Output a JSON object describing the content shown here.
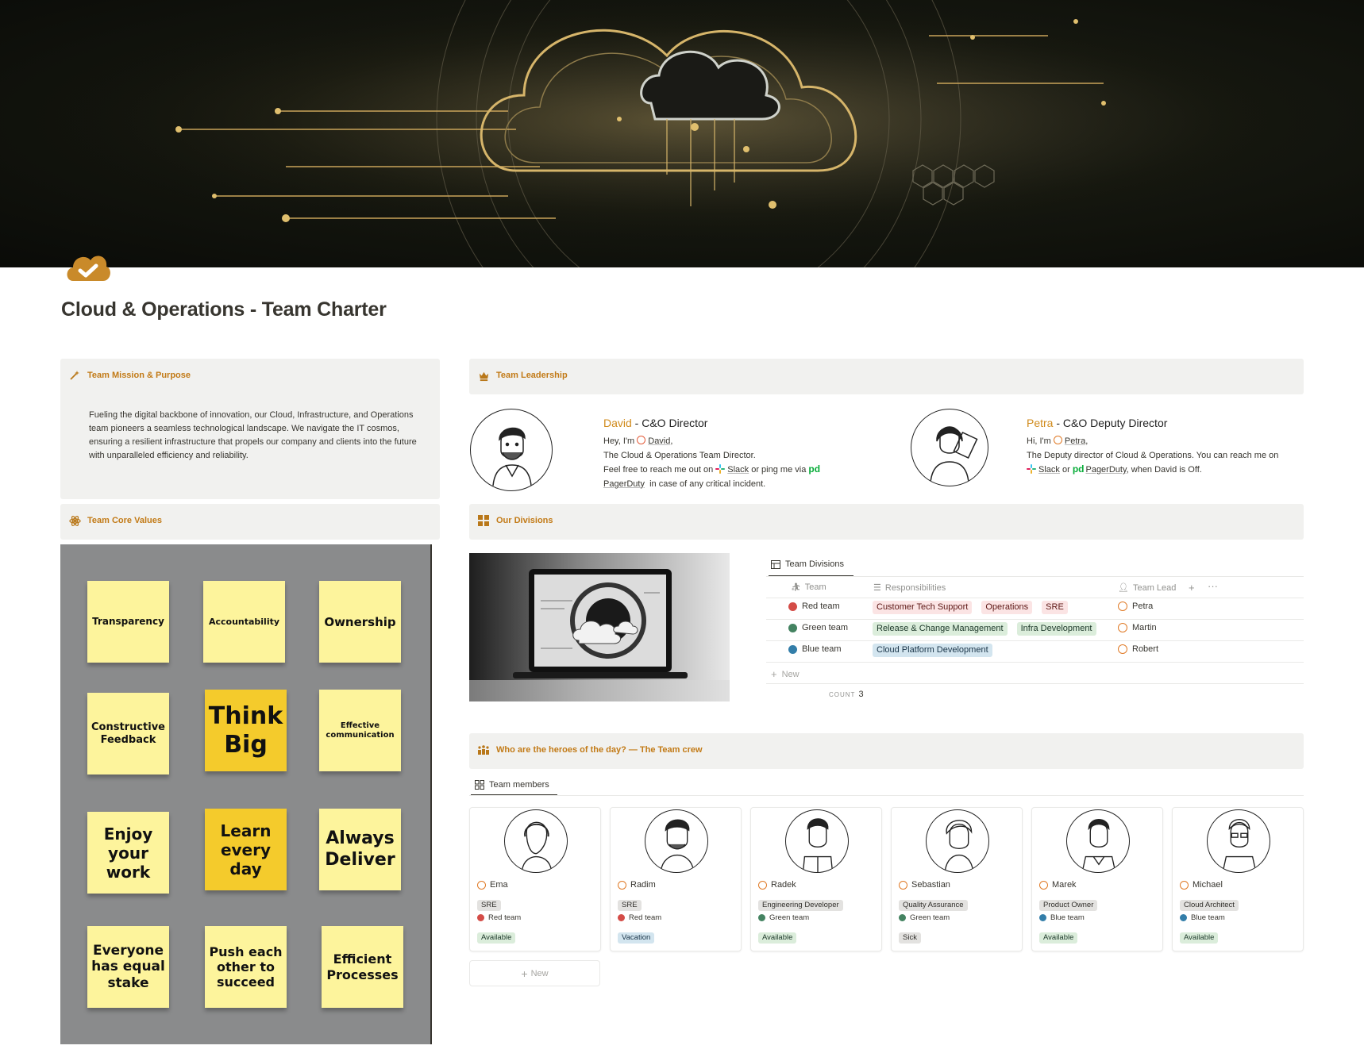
{
  "page": {
    "title": "Cloud & Operations - Team Charter",
    "icon": "cloud-check-icon"
  },
  "mission": {
    "heading": "Team Mission & Purpose",
    "icon": "magic-wand-icon",
    "text": "Fueling the digital backbone of innovation, our Cloud, Infrastructure, and Operations team pioneers a seamless technological landscape. We navigate the IT cosmos, ensuring a resilient infrastructure that propels our company and clients into the future with unparalleled efficiency and reliability."
  },
  "values": {
    "heading": "Team Core Values",
    "icon": "atom-icon",
    "notes": [
      "Transparency",
      "Accountability",
      "Ownership",
      "Constructive Feedback",
      "Think Big",
      "Effective communication",
      "Enjoy your work",
      "Learn every day",
      "Always Deliver",
      "Everyone has equal stake",
      "Push each other to succeed",
      "Efficient Processes"
    ]
  },
  "leadership": {
    "heading": "Team Leadership",
    "icon": "crown-icon",
    "david": {
      "name": "David",
      "title": " - C&O Director",
      "hey": "Hey, I'm",
      "mention": "David",
      "line2": "The Cloud & Operations Team Director.",
      "line3a": "Feel free to reach me out on",
      "slack": "Slack",
      "line3b": "or ping me via",
      "pagerduty": "PagerDuty",
      "line4": "in case of any critical incident."
    },
    "petra": {
      "name": "Petra",
      "title": " - C&O Deputy Director",
      "hi": "Hi, I'm",
      "mention": "Petra",
      "line2": "The Deputy director of Cloud & Operations. You can reach me on",
      "slack": "Slack",
      "or": "or",
      "pagerduty": "PagerDuty",
      "tail": ", when David is Off."
    }
  },
  "divisions": {
    "heading": "Our Divisions",
    "icon": "grid-icon",
    "view_label": "Team Divisions",
    "columns": {
      "team": "Team",
      "responsibilities": "Responsibilities",
      "lead": "Team Lead"
    },
    "rows": [
      {
        "team": "Red team",
        "color": "#d44c47",
        "tags": [
          "Customer Tech Support",
          "Operations",
          "SRE"
        ],
        "tag_color": "red",
        "lead": "Petra"
      },
      {
        "team": "Green team",
        "color": "#448361",
        "tags": [
          "Release & Change Management",
          "Infra Development"
        ],
        "tag_color": "green",
        "lead": "Martin"
      },
      {
        "team": "Blue team",
        "color": "#337ea9",
        "tags": [
          "Cloud Platform Development"
        ],
        "tag_color": "blue",
        "lead": "Robert"
      }
    ],
    "new_label": "New",
    "count_label": "COUNT",
    "count_value": "3"
  },
  "crew": {
    "heading": "Who are the heroes of the day? — The Team crew",
    "icon": "people-icon",
    "view_label": "Team members",
    "members": [
      {
        "name": "Ema",
        "role": "SRE",
        "team": "Red team",
        "team_color": "#d44c47",
        "status": "Available",
        "status_color": "green"
      },
      {
        "name": "Radim",
        "role": "SRE",
        "team": "Red team",
        "team_color": "#d44c47",
        "status": "Vacation",
        "status_color": "blue"
      },
      {
        "name": "Radek",
        "role": "Engineering Developer",
        "team": "Green team",
        "team_color": "#448361",
        "status": "Available",
        "status_color": "green"
      },
      {
        "name": "Sebastian",
        "role": "Quality Assurance",
        "team": "Green team",
        "team_color": "#448361",
        "status": "Sick",
        "status_color": "gray"
      },
      {
        "name": "Marek",
        "role": "Product Owner",
        "team": "Blue team",
        "team_color": "#337ea9",
        "status": "Available",
        "status_color": "green"
      },
      {
        "name": "Michael",
        "role": "Cloud Architect",
        "team": "Blue team",
        "team_color": "#337ea9",
        "status": "Available",
        "status_color": "green"
      }
    ],
    "new_label": "New"
  }
}
